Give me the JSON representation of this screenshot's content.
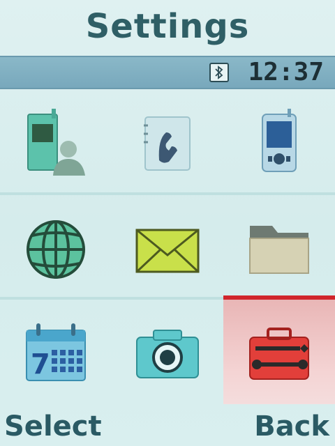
{
  "header": {
    "title": "Settings"
  },
  "status_bar": {
    "bluetooth_icon": "bluetooth-icon",
    "time": "12:37"
  },
  "menu_grid": {
    "items": [
      {
        "icon": "phone-profile-icon"
      },
      {
        "icon": "call-settings-icon"
      },
      {
        "icon": "display-settings-icon"
      },
      {
        "icon": "network-globe-icon"
      },
      {
        "icon": "messages-envelope-icon"
      },
      {
        "icon": "folder-icon"
      },
      {
        "icon": "calendar-icon"
      },
      {
        "icon": "camera-icon"
      },
      {
        "icon": "toolbox-settings-icon",
        "selected": true
      }
    ],
    "selected_index": 8
  },
  "softkeys": {
    "left": "Select",
    "right": "Back"
  },
  "colors": {
    "background": "#d8eeee",
    "title": "#2f5f66",
    "status_bar": "#80b0c2",
    "selection_border": "#d0252c",
    "softkey_text": "#2a5a64"
  }
}
